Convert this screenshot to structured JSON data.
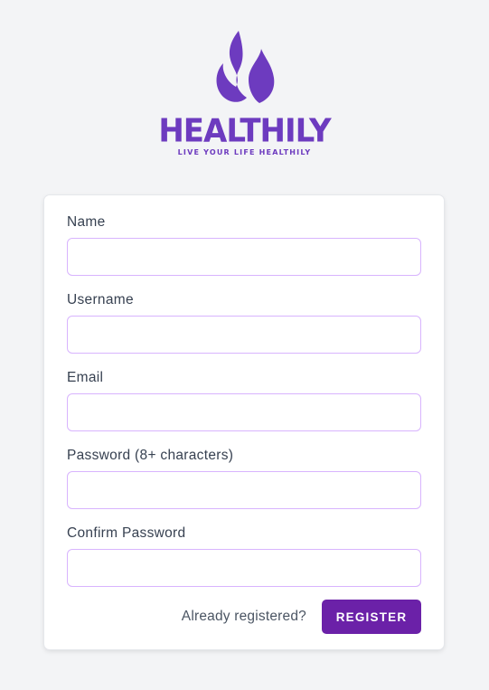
{
  "brand": {
    "name": "HEALTHILY",
    "tagline": "LIVE YOUR LIFE HEALTHILY",
    "color": "#6d3bbf",
    "logo_icon": "flame-icon"
  },
  "form": {
    "fields": [
      {
        "label": "Name",
        "value": ""
      },
      {
        "label": "Username",
        "value": ""
      },
      {
        "label": "Email",
        "value": ""
      },
      {
        "label": "Password (8+ characters)",
        "value": ""
      },
      {
        "label": "Confirm Password",
        "value": ""
      }
    ],
    "input_border_color": "#d8b4fe",
    "already_registered_link": "Already registered?",
    "submit_label": "REGISTER",
    "submit_color": "#6b21a8"
  }
}
